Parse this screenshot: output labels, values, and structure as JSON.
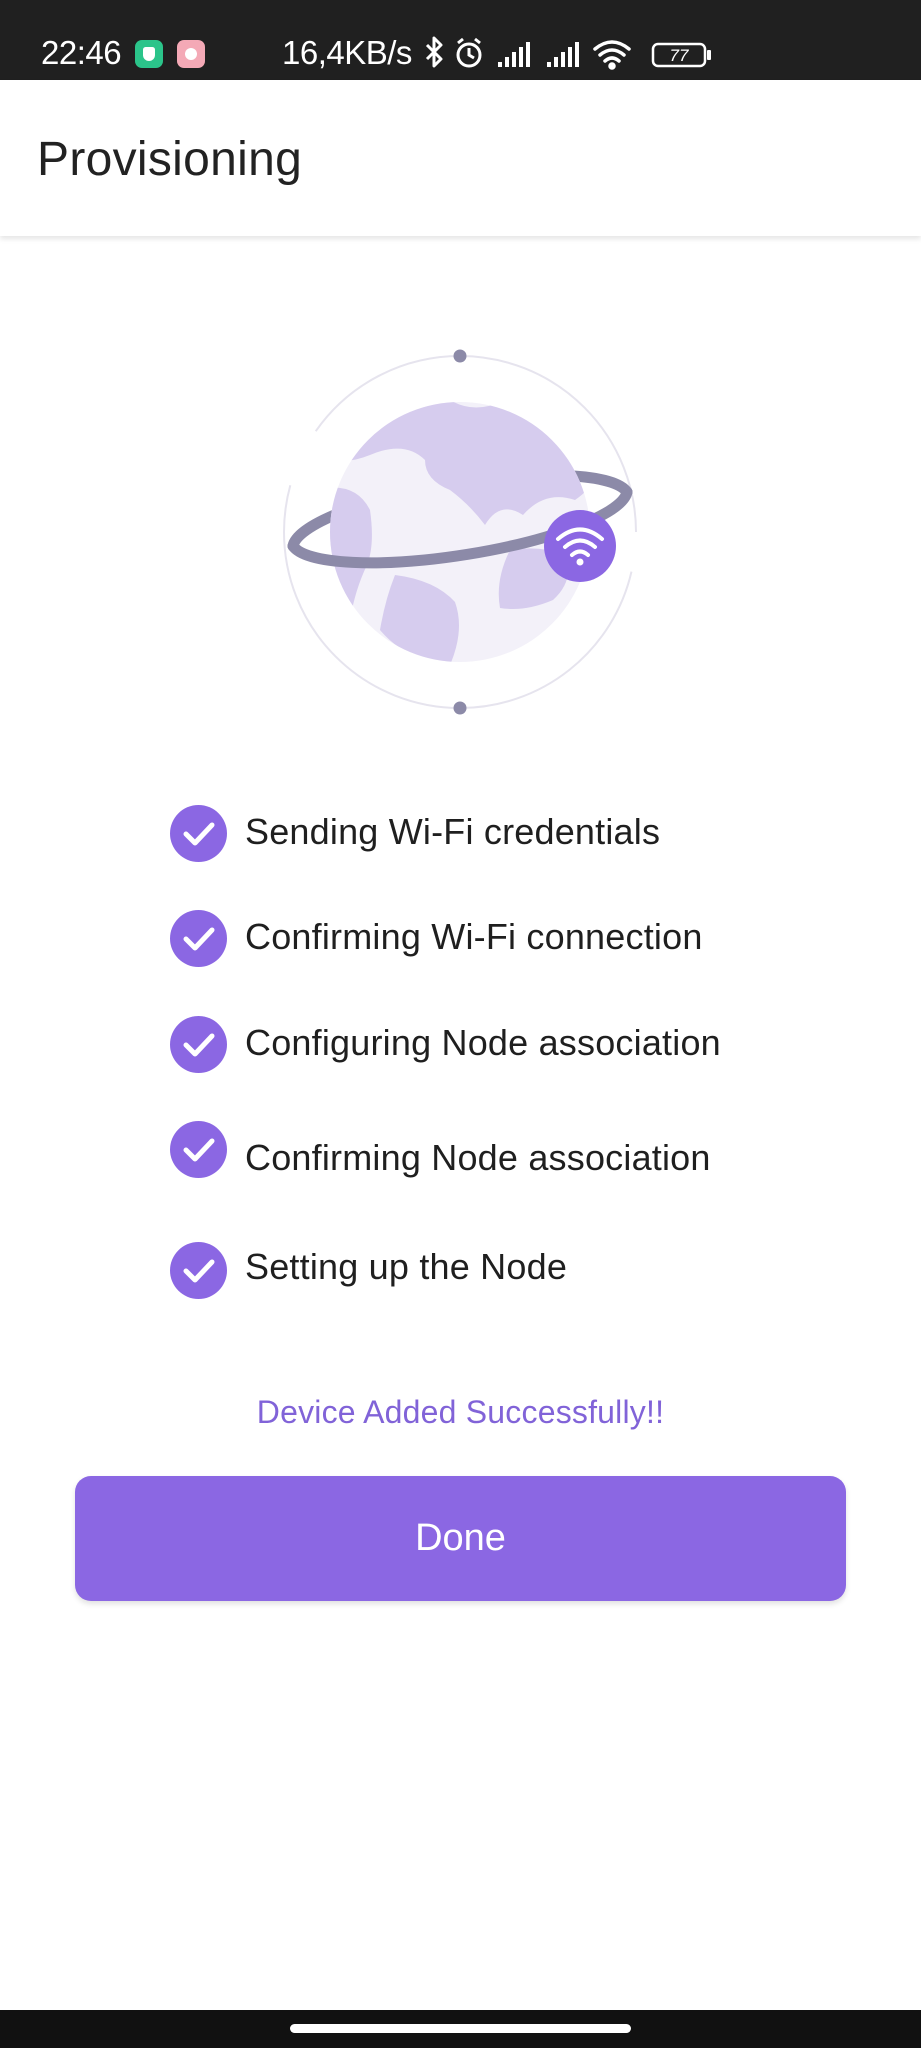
{
  "status_bar": {
    "time": "22:46",
    "net_speed": "16,4KB/s",
    "battery": "77",
    "icons": [
      "vpn-shield-app-icon",
      "app-notification-icon",
      "bluetooth-icon",
      "alarm-icon",
      "signal-icon",
      "signal-icon",
      "wifi-icon",
      "battery-icon"
    ]
  },
  "app_bar": {
    "title": "Provisioning"
  },
  "steps": [
    {
      "label": "Sending Wi-Fi credentials",
      "status": "done"
    },
    {
      "label": "Confirming Wi-Fi connection",
      "status": "done"
    },
    {
      "label": "Configuring Node association",
      "status": "done"
    },
    {
      "label": "Confirming Node association",
      "status": "done"
    },
    {
      "label": "Setting up the Node",
      "status": "done"
    }
  ],
  "success_message": "Device Added Successfully!!",
  "done_button": {
    "label": "Done"
  },
  "colors": {
    "accent": "#8b67e3",
    "success_text": "#8163d8",
    "globe_fill": "#f3f1f9",
    "continents": "#d6ccee",
    "orbit": "#8c8aa8"
  }
}
